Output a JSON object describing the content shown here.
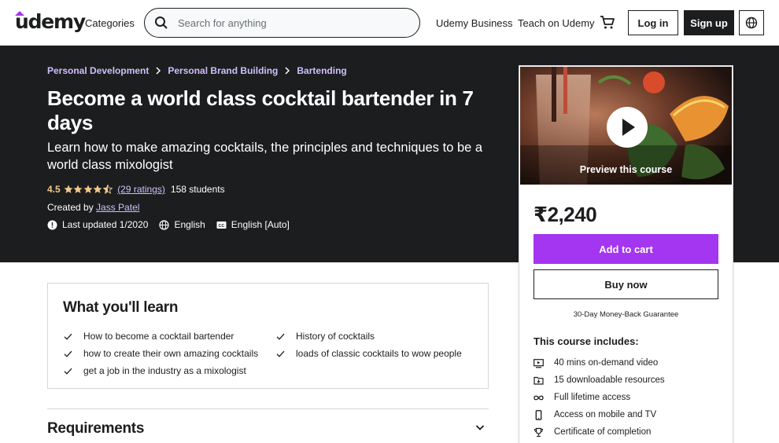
{
  "nav": {
    "logo": "udemy",
    "categories": "Categories",
    "search_placeholder": "Search for anything",
    "business": "Udemy Business",
    "teach": "Teach on Udemy",
    "login": "Log in",
    "signup": "Sign up"
  },
  "breadcrumbs": [
    "Personal Development",
    "Personal Brand Building",
    "Bartending"
  ],
  "course": {
    "title": "Become a world class cocktail bartender in 7 days",
    "subtitle": "Learn how to make amazing cocktails, the principles and techniques to be a world class mixologist",
    "rating": "4.5",
    "stars": 4.5,
    "ratings_count": "(29 ratings)",
    "students": "158 students",
    "created_by_label": "Created by",
    "author": "Jass Patel",
    "last_updated": "Last updated 1/2020",
    "language": "English",
    "captions": "English [Auto]"
  },
  "sidebar": {
    "preview_label": "Preview this course",
    "price": "₹2,240",
    "add_to_cart": "Add to cart",
    "buy_now": "Buy now",
    "guarantee": "30-Day Money-Back Guarantee",
    "includes_title": "This course includes:",
    "includes": [
      {
        "icon": "video-icon",
        "text": "40 mins on-demand video"
      },
      {
        "icon": "download-file-icon",
        "text": "15 downloadable resources"
      },
      {
        "icon": "infinity-icon",
        "text": "Full lifetime access"
      },
      {
        "icon": "mobile-icon",
        "text": "Access on mobile and TV"
      },
      {
        "icon": "trophy-icon",
        "text": "Certificate of completion"
      }
    ]
  },
  "learn": {
    "title": "What you'll learn",
    "col1": [
      "How to become a cocktail bartender",
      "how to create their own amazing cocktails",
      "get a job in the industry as a mixologist"
    ],
    "col2": [
      "History of cocktails",
      "loads of classic cocktails to wow people"
    ]
  },
  "requirements": {
    "title": "Requirements"
  },
  "colors": {
    "accent_purple": "#a435f0",
    "link_lavender": "#cec0fc",
    "rating_gold": "#f3ca8c",
    "hero_dark": "#1c1d1f"
  }
}
